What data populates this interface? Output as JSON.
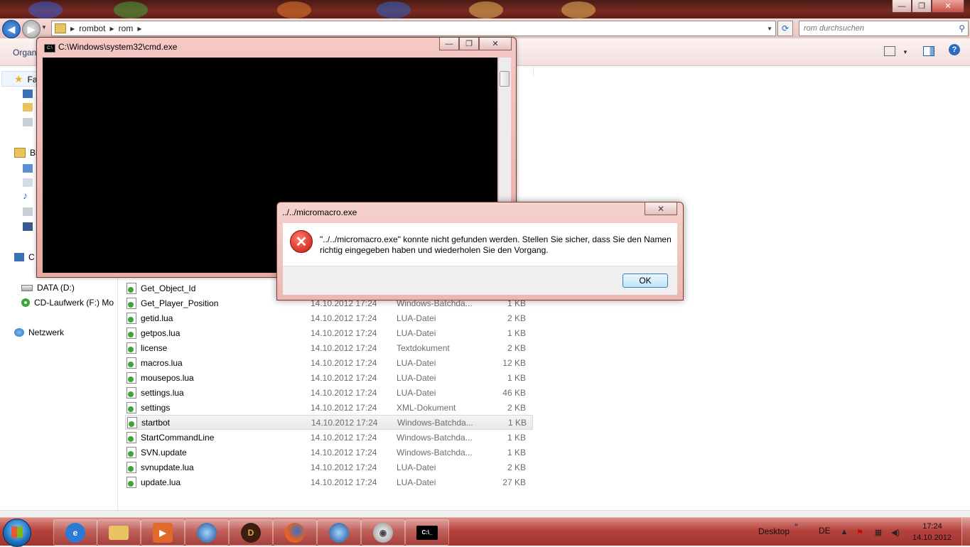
{
  "explorer": {
    "breadcrumb": [
      "rombot",
      "rom"
    ],
    "search_placeholder": "rom durchsuchen",
    "toolbar_organize": "Organ",
    "nav": [
      {
        "label": "Fa",
        "icon": "star-icon"
      },
      {
        "label": "Bi",
        "icon": "library-icon"
      },
      {
        "label": "C",
        "icon": "computer-icon"
      },
      {
        "label": "DATA (D:)",
        "icon": "drive-icon"
      },
      {
        "label": "CD-Laufwerk (F:) Mo",
        "icon": "cd-drive-icon"
      },
      {
        "label": "Netzwerk",
        "icon": "network-icon"
      }
    ],
    "files": [
      {
        "name": "Get_Object_Id",
        "date": "",
        "type": "",
        "size": ""
      },
      {
        "name": "Get_Player_Position",
        "date": "14.10.2012 17:24",
        "type": "Windows-Batchda...",
        "size": "1 KB"
      },
      {
        "name": "getid.lua",
        "date": "14.10.2012 17:24",
        "type": "LUA-Datei",
        "size": "2 KB"
      },
      {
        "name": "getpos.lua",
        "date": "14.10.2012 17:24",
        "type": "LUA-Datei",
        "size": "1 KB"
      },
      {
        "name": "license",
        "date": "14.10.2012 17:24",
        "type": "Textdokument",
        "size": "2 KB"
      },
      {
        "name": "macros.lua",
        "date": "14.10.2012 17:24",
        "type": "LUA-Datei",
        "size": "12 KB"
      },
      {
        "name": "mousepos.lua",
        "date": "14.10.2012 17:24",
        "type": "LUA-Datei",
        "size": "1 KB"
      },
      {
        "name": "settings.lua",
        "date": "14.10.2012 17:24",
        "type": "LUA-Datei",
        "size": "46 KB"
      },
      {
        "name": "settings",
        "date": "14.10.2012 17:24",
        "type": "XML-Dokument",
        "size": "2 KB"
      },
      {
        "name": "startbot",
        "date": "14.10.2012 17:24",
        "type": "Windows-Batchda...",
        "size": "1 KB"
      },
      {
        "name": "StartCommandLine",
        "date": "14.10.2012 17:24",
        "type": "Windows-Batchda...",
        "size": "1 KB"
      },
      {
        "name": "SVN.update",
        "date": "14.10.2012 17:24",
        "type": "Windows-Batchda...",
        "size": "1 KB"
      },
      {
        "name": "svnupdate.lua",
        "date": "14.10.2012 17:24",
        "type": "LUA-Datei",
        "size": "2 KB"
      },
      {
        "name": "update.lua",
        "date": "14.10.2012 17:24",
        "type": "LUA-Datei",
        "size": "27 KB"
      }
    ],
    "selected_file": "startbot"
  },
  "cmd": {
    "title": "C:\\Windows\\system32\\cmd.exe",
    "icon_label": "C:\\"
  },
  "dialog": {
    "title": "../../micromacro.exe",
    "message": "\"../../micromacro.exe\" konnte nicht gefunden werden. Stellen Sie sicher, dass Sie den Namen richtig eingegeben haben und wiederholen Sie den Vorgang.",
    "ok_label": "OK"
  },
  "taskbar": {
    "apps": [
      "ie-icon",
      "folder-icon",
      "media-player-icon",
      "game-launcher-icon",
      "diablo-icon",
      "firefox-icon",
      "game-launcher-icon",
      "speaker-app-icon",
      "cmd-icon"
    ],
    "desktop_label": "Desktop",
    "language": "DE",
    "time": "17:24",
    "date": "14.10.2012"
  },
  "colors": {
    "accent_titlebar": "#7a2a22",
    "taskbar": "#b7423c",
    "error_red": "#c4160f"
  }
}
